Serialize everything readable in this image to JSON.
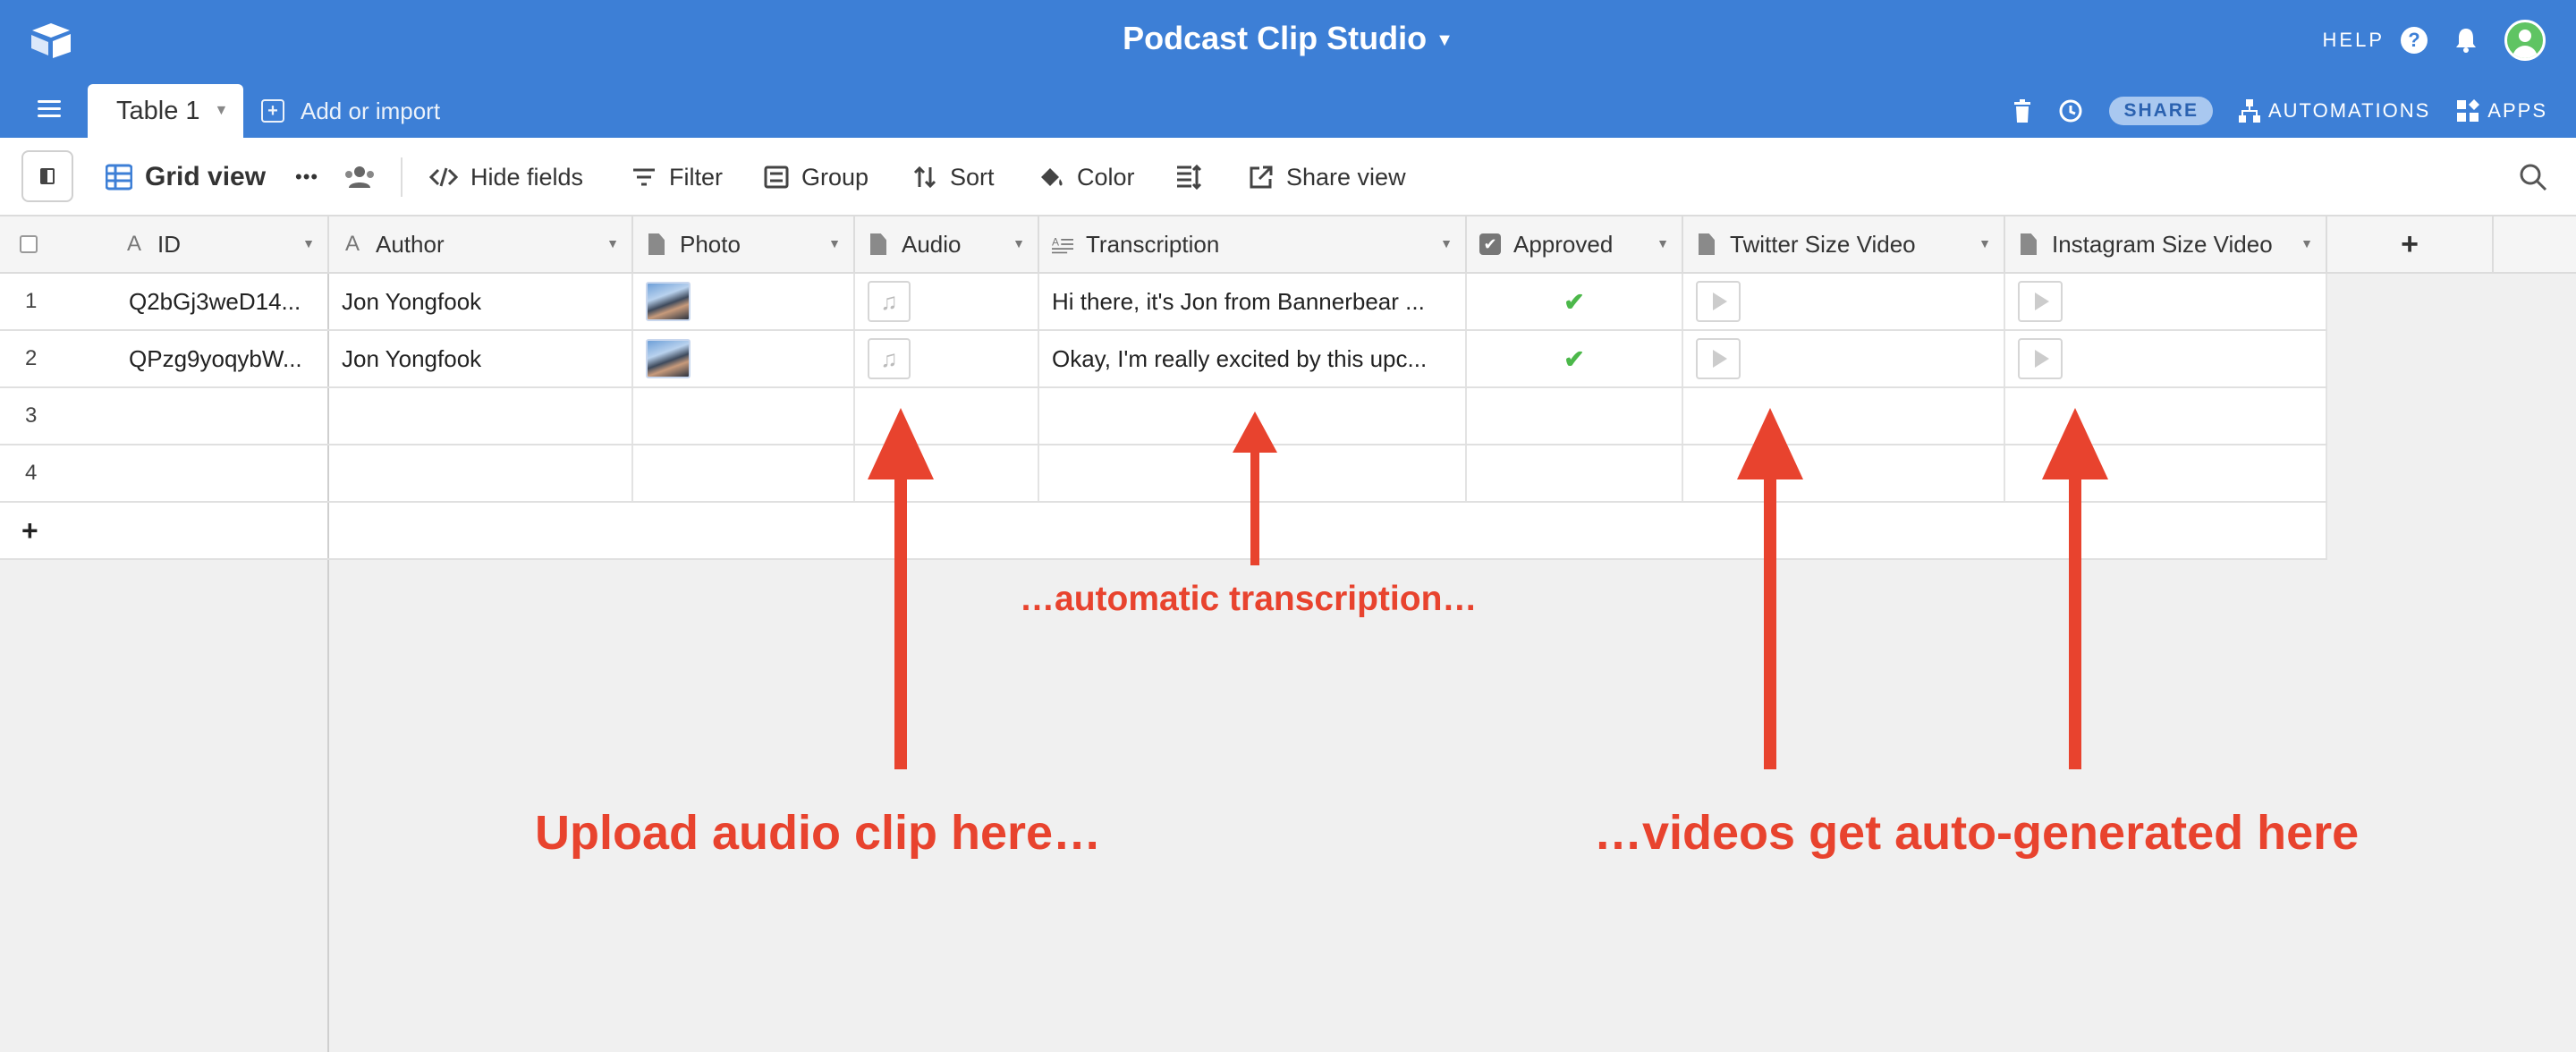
{
  "app": {
    "title": "Podcast Clip Studio"
  },
  "topbar": {
    "help_label": "HELP",
    "help_icon": "?"
  },
  "tabs": {
    "active_label": "Table 1",
    "add_import_label": "Add or import"
  },
  "tab_actions": {
    "share_label": "SHARE",
    "automations_label": "AUTOMATIONS",
    "apps_label": "APPS"
  },
  "toolbar": {
    "view_name": "Grid view",
    "more_label": "•••",
    "hide_fields_label": "Hide fields",
    "filter_label": "Filter",
    "group_label": "Group",
    "sort_label": "Sort",
    "color_label": "Color",
    "share_view_label": "Share view"
  },
  "columns": [
    "ID",
    "Author",
    "Photo",
    "Audio",
    "Transcription",
    "Approved",
    "Twitter Size Video",
    "Instagram Size Video"
  ],
  "add_column_label": "+",
  "rows": [
    {
      "num": "1",
      "id": "Q2bGj3weD14...",
      "author": "Jon Yongfook",
      "transcription": "Hi there, it's Jon from Bannerbear ...",
      "approved": true
    },
    {
      "num": "2",
      "id": "QPzg9yoqybW...",
      "author": "Jon Yongfook",
      "transcription": "Okay, I'm really excited by this upc...",
      "approved": true
    },
    {
      "num": "3"
    },
    {
      "num": "4"
    }
  ],
  "add_row_label": "+",
  "annotations": {
    "transcription": "…automatic transcription…",
    "upload": "Upload audio clip here…",
    "videos": "…videos get auto-generated here"
  },
  "colors": {
    "brand_blue": "#3d7fd6",
    "annotation_red": "#e8432e",
    "approved_green": "#4cb84a"
  }
}
